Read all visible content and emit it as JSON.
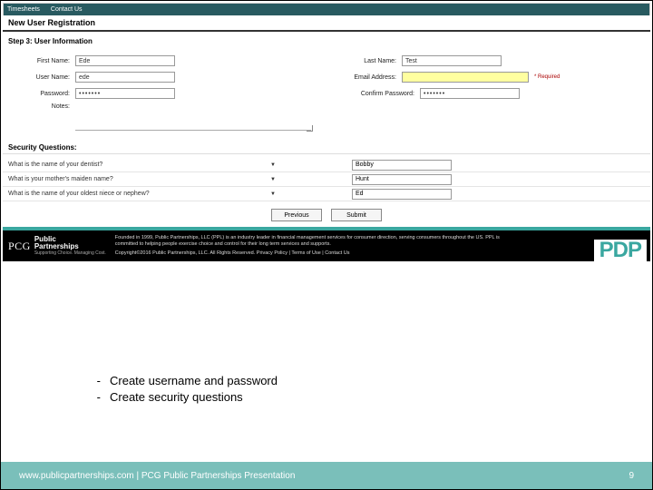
{
  "topnav": {
    "item1": "Timesheets",
    "item2": "Contact Us"
  },
  "titlebar": {
    "text": "New User Registration"
  },
  "step": {
    "text": "Step 3: User Information"
  },
  "form": {
    "firstNameLabel": "First Name:",
    "firstNameValue": "Ede",
    "lastNameLabel": "Last Name:",
    "lastNameValue": "Test",
    "userNameLabel": "User Name:",
    "userNameValue": "ede",
    "emailLabel": "Email Address:",
    "emailValue": "",
    "emailRequired": "* Required",
    "passwordLabel": "Password:",
    "passwordValue": "•••••••",
    "confirmLabel": "Confirm Password:",
    "confirmValue": "•••••••",
    "notesLabel": "Notes:"
  },
  "security": {
    "heading": "Security Questions:",
    "q1": "What is the name of your dentist?",
    "a1": "Bobby",
    "q2": "What is your mother's maiden name?",
    "a2": "Hunt",
    "q3": "What is the name of your oldest niece or nephew?",
    "a3": "Ed"
  },
  "buttons": {
    "prev": "Previous",
    "submit": "Submit"
  },
  "footer": {
    "brand1": "PCG",
    "brand2": "Public",
    "brand3": "Partnerships",
    "brandSub": "Supporting Choice. Managing Cost.",
    "line1": "Founded in 1999, Public Partnerships, LLC (PPL) is an industry leader in financial management services for consumer direction, serving consumers throughout the US. PPL is committed to helping people exercise choice and control for their long term services and supports.",
    "line2": "Copyright©2016 Public Partnerships, LLC. All Rights Reserved. Privacy Policy | Terms of Use | Contact Us",
    "pdp": "PDP"
  },
  "bullets": {
    "b1": "Create username and password",
    "b2": "Create security questions"
  },
  "slideFooter": {
    "left": "www.publicpartnerships.com | PCG Public Partnerships Presentation",
    "page": "9"
  }
}
